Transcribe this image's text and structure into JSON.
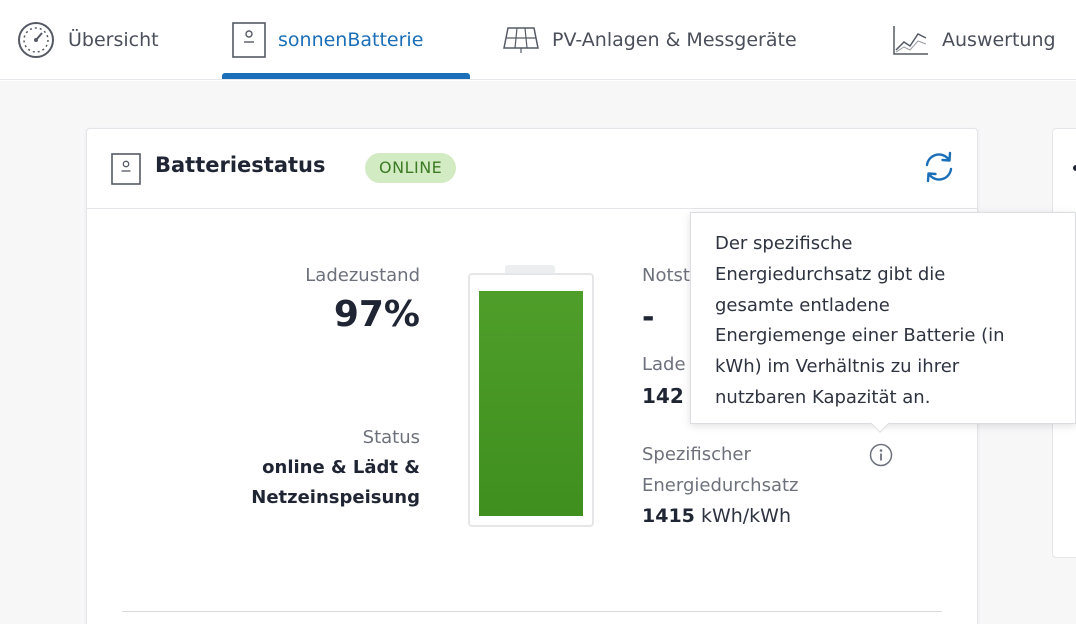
{
  "nav": {
    "tabs": [
      {
        "label": "Übersicht",
        "icon": "speedometer-icon"
      },
      {
        "label": "sonnenBatterie",
        "icon": "battery-box-icon"
      },
      {
        "label": "PV-Anlagen & Messgeräte",
        "icon": "solar-panel-icon"
      },
      {
        "label": "Auswertung",
        "icon": "line-chart-icon"
      }
    ],
    "active_tab": "sonnenBatterie"
  },
  "card": {
    "title": "Batteriestatus",
    "status_badge": "ONLINE",
    "icons": {
      "header": "battery-box-icon",
      "refresh": "refresh-icon"
    }
  },
  "left": {
    "soc_label": "Ladezustand",
    "soc_value": "97%",
    "status_label": "Status",
    "status_line1": "online & Lädt &",
    "status_line2": "Netzeinspeisung"
  },
  "battery": {
    "fill_fraction": 0.97,
    "color": "#3f8f1f"
  },
  "right": {
    "notstrom_label_partial": "Notst",
    "notstrom_value": "-",
    "ladezyklen_label_partial": "Lade",
    "ladezyklen_value_partial": "142",
    "specific_label_line1": "Spezifischer",
    "specific_label_line2": "Energiedurchsatz",
    "specific_value": "1415",
    "specific_unit": "kWh/kWh"
  },
  "tooltip": {
    "lines": [
      "Der spezifische",
      "Energiedurchsatz gibt die",
      "gesamte entladene",
      "Energiemenge einer Batterie (in",
      "kWh) im Verhältnis zu ihrer",
      "nutzbaren Kapazität an."
    ]
  },
  "colors": {
    "accent": "#1b6fb8",
    "badge_bg": "#d3ebc3",
    "badge_text": "#3c7a25",
    "battery_green": "#3f8f1f"
  }
}
